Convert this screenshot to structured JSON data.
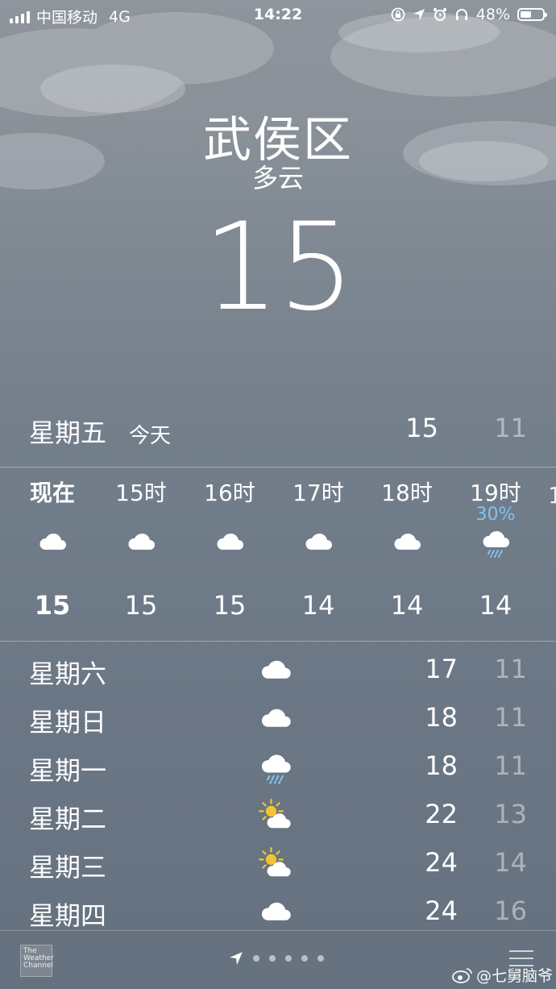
{
  "status_bar": {
    "carrier": "中国移动",
    "network": "4G",
    "time": "14:22",
    "battery": "48%",
    "battery_level": 0.48
  },
  "location": {
    "city": "武侯区",
    "condition": "多云",
    "temperature": "15"
  },
  "today": {
    "day": "星期五",
    "label": "今天",
    "high": "15",
    "low": "11"
  },
  "hourly": [
    {
      "time": "现在",
      "temp": "15",
      "icon": "cloud-icon",
      "pop": ""
    },
    {
      "time": "15时",
      "temp": "15",
      "icon": "cloud-icon",
      "pop": ""
    },
    {
      "time": "16时",
      "temp": "15",
      "icon": "cloud-icon",
      "pop": ""
    },
    {
      "time": "17时",
      "temp": "14",
      "icon": "cloud-icon",
      "pop": ""
    },
    {
      "time": "18时",
      "temp": "14",
      "icon": "cloud-icon",
      "pop": ""
    },
    {
      "time": "19时",
      "temp": "14",
      "icon": "rain-cloud-icon",
      "pop": "30%"
    }
  ],
  "daily": [
    {
      "day": "星期六",
      "icon": "cloud-icon",
      "high": "17",
      "low": "11"
    },
    {
      "day": "星期日",
      "icon": "cloud-icon",
      "high": "18",
      "low": "11"
    },
    {
      "day": "星期一",
      "icon": "rain-cloud-icon",
      "high": "18",
      "low": "11"
    },
    {
      "day": "星期二",
      "icon": "partly-sunny-icon",
      "high": "22",
      "low": "13"
    },
    {
      "day": "星期三",
      "icon": "partly-sunny-icon",
      "high": "24",
      "low": "14"
    },
    {
      "day": "星期四",
      "icon": "cloud-icon",
      "high": "24",
      "low": "16"
    }
  ],
  "footer": {
    "logo_text": "The Weather Channel",
    "page_count": 5,
    "watermark": "@七舅脑爷"
  },
  "colors": {
    "precip": "#7ec3f0",
    "sun": "#f4c430",
    "low_temp": "rgba(255,255,255,0.45)"
  }
}
